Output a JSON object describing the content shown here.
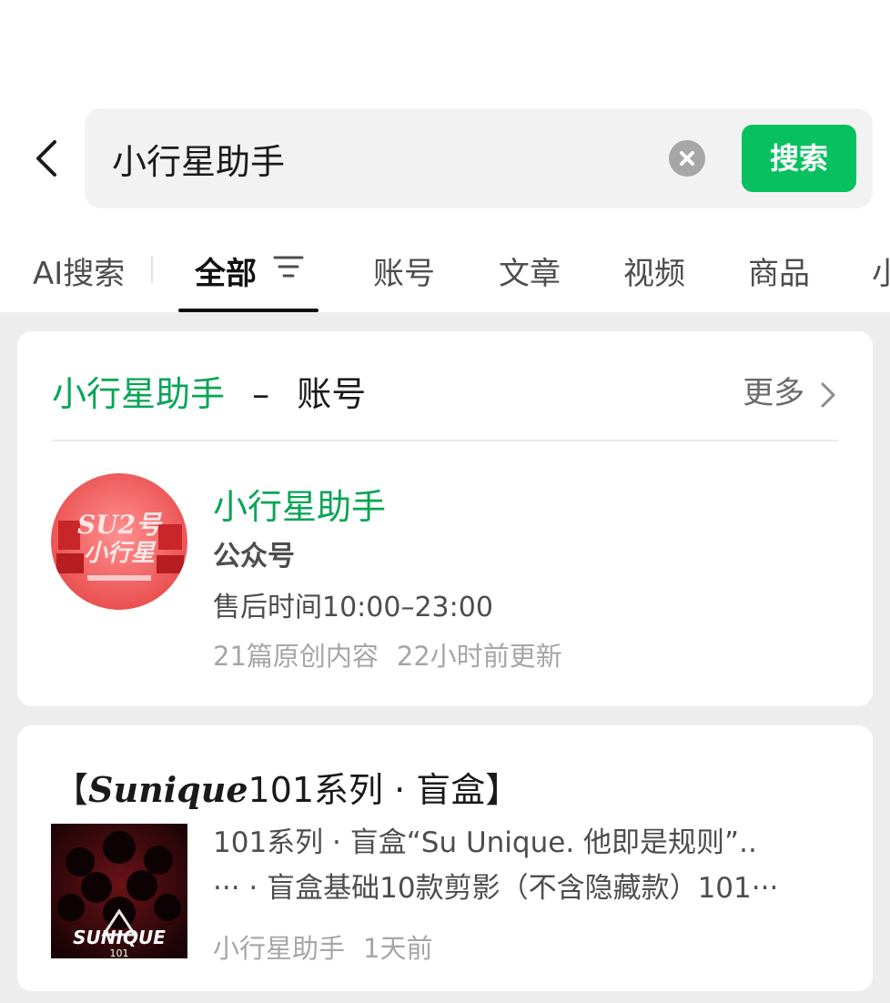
{
  "search": {
    "query": "小行星助手",
    "button_label": "搜索"
  },
  "tabs": [
    {
      "label": "AI搜索"
    },
    {
      "label": "全部",
      "active": true
    },
    {
      "label": "账号"
    },
    {
      "label": "文章"
    },
    {
      "label": "视频"
    },
    {
      "label": "商品"
    },
    {
      "label": "小"
    }
  ],
  "account_section": {
    "query": "小行星助手",
    "dash": "–",
    "type": "账号",
    "more_label": "更多",
    "account": {
      "name": "小行星助手",
      "kind": "公众号",
      "description": "售后时间10:00–23:00",
      "articles": "21篇原创内容",
      "updated": "22小时前更新",
      "avatar_text": "SU2号小行星"
    }
  },
  "article": {
    "title_open": "【",
    "title_brand": "Sunique",
    "title_rest": "101系列 · 盲盒】",
    "snippet_line1": "101系列 · 盲盒“Su Unique. 他即是规则”..",
    "snippet_line2": "··· · 盲盒基础10款剪影（不含隐藏款）101···",
    "source": "小行星助手",
    "time": "1天前",
    "thumb_text": "SUNIQUE",
    "thumb_subtext": "101"
  },
  "colors": {
    "accent": "#07c160",
    "link_green": "#07a555",
    "background": "#ededed"
  }
}
